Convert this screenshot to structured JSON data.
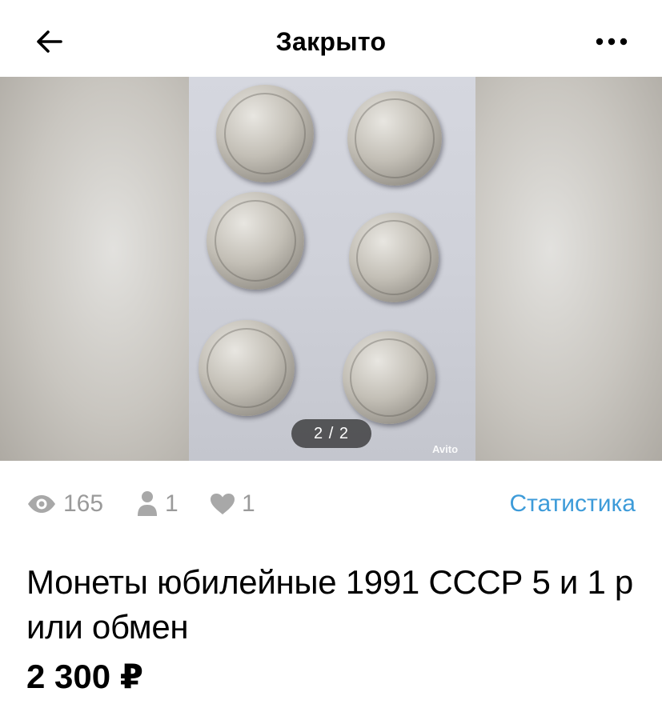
{
  "header": {
    "title": "Закрыто",
    "back_icon": "arrow-left-icon",
    "more_icon": "more-dots-icon"
  },
  "gallery": {
    "counter": "2 / 2",
    "watermark": "Avito",
    "current_index": 2,
    "total": 2
  },
  "stats": {
    "views": "165",
    "contacts": "1",
    "favorites": "1",
    "link_label": "Статистика",
    "link_color": "#3d9bd9"
  },
  "listing": {
    "title": "Монеты юбилейные 1991 СССР 5 и 1 р или обмен",
    "price": "2 300 ₽"
  }
}
